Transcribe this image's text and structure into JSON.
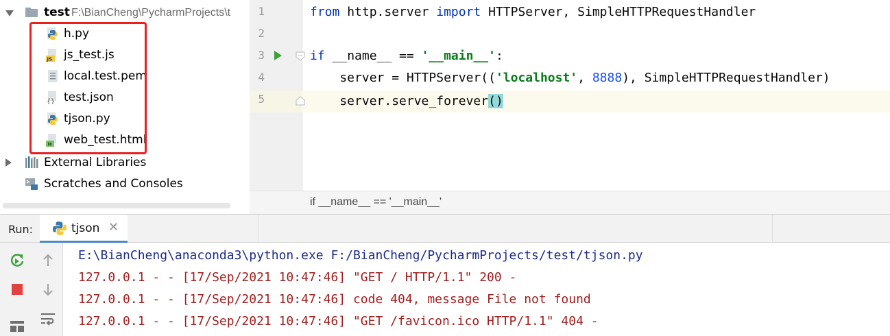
{
  "project_tree": {
    "root": {
      "name": "test",
      "path": "F:\\BianCheng\\PycharmProjects\\t"
    },
    "files": [
      {
        "name": "h.py",
        "icon": "python-file-icon"
      },
      {
        "name": "js_test.js",
        "icon": "javascript-file-icon"
      },
      {
        "name": "local.test.pem",
        "icon": "text-file-icon"
      },
      {
        "name": "test.json",
        "icon": "json-file-icon"
      },
      {
        "name": "tjson.py",
        "icon": "python-file-icon"
      },
      {
        "name": "web_test.html",
        "icon": "html-file-icon"
      }
    ],
    "external_libraries": "External Libraries",
    "scratches": "Scratches and Consoles"
  },
  "editor": {
    "line_numbers": [
      "1",
      "2",
      "3",
      "4",
      "5"
    ],
    "lines": {
      "l1": {
        "kw1": "from",
        "mod": " http.server ",
        "kw2": "import",
        "rest": " HTTPServer, SimpleHTTPRequestHandler"
      },
      "l3": {
        "kw": "if",
        "mid": " __name__ == ",
        "str": "'__main__'",
        "end": ":"
      },
      "l4": {
        "pre": "    server = HTTPServer((",
        "str": "'localhost'",
        "comma": ", ",
        "num": "8888",
        "post": "), SimpleHTTPRequestHandler)"
      },
      "l5": {
        "pre": "    server.serve_forever",
        "brace_open": "(",
        "brace_close": ")"
      }
    },
    "breadcrumb": "if __name__ == '__main__'"
  },
  "run_panel": {
    "label": "Run:",
    "tab": "tjson",
    "close_glyph": "✕",
    "console": [
      "E:\\BianCheng\\anaconda3\\python.exe F:/BianCheng/PycharmProjects/test/tjson.py",
      "127.0.0.1 - - [17/Sep/2021 10:47:46] \"GET / HTTP/1.1\" 200 -",
      "127.0.0.1 - - [17/Sep/2021 10:47:46] code 404, message File not found",
      "127.0.0.1 - - [17/Sep/2021 10:47:46] \"GET /favicon.ico HTTP/1.1\" 404 -"
    ]
  },
  "colors": {
    "keyword": "#0033b3",
    "string": "#067d17",
    "number": "#1750eb",
    "console_command": "#1b2b8a",
    "console_log": "#a02020",
    "highlight_box": "#ec1f1f",
    "tab_underline": "#4a88c7"
  }
}
